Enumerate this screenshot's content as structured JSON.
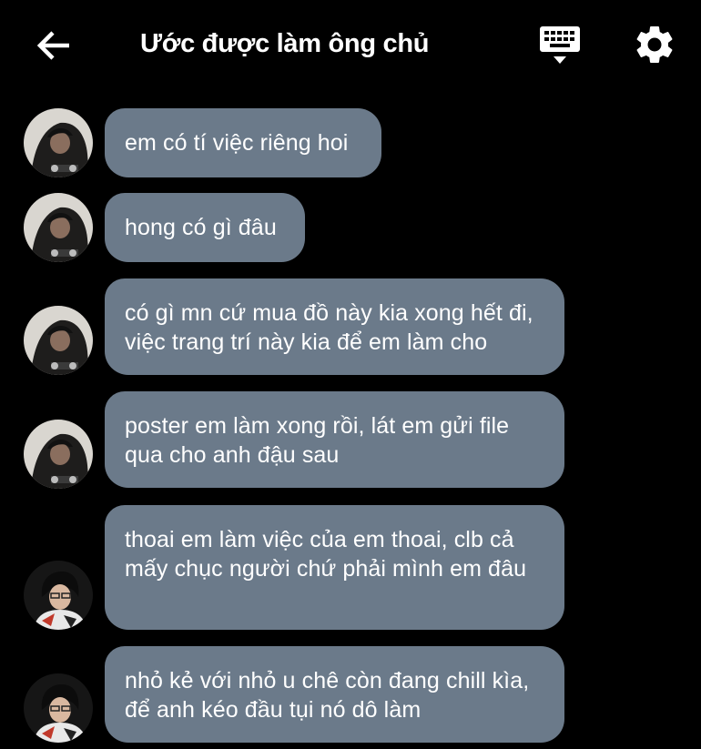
{
  "header": {
    "title": "Ước được làm ông chủ",
    "back_icon": "arrow-left-icon",
    "keyboard_icon": "keyboard-icon",
    "settings_icon": "gear-icon"
  },
  "messages": [
    {
      "sender": "person-a",
      "text": "em có tí việc riêng hoi"
    },
    {
      "sender": "person-a",
      "text": "hong có gì đâu"
    },
    {
      "sender": "person-a",
      "text": "có gì mn cứ mua đồ này kia xong hết đi, việc trang trí này kia để em làm cho"
    },
    {
      "sender": "person-a",
      "text": "poster em làm xong rồi, lát em gửi file qua cho anh đậu sau"
    },
    {
      "sender": "person-b",
      "text": "thoai em làm việc của em thoai, clb cả mấy chục người chứ phải mình em đâu"
    },
    {
      "sender": "person-b",
      "text": "nhỏ kẻ với nhỏ u chê còn đang chill kìa, để anh kéo đầu tụi nó dô làm"
    }
  ],
  "colors": {
    "background": "#000000",
    "bubble": "#6b7a8a",
    "text": "#ffffff"
  }
}
